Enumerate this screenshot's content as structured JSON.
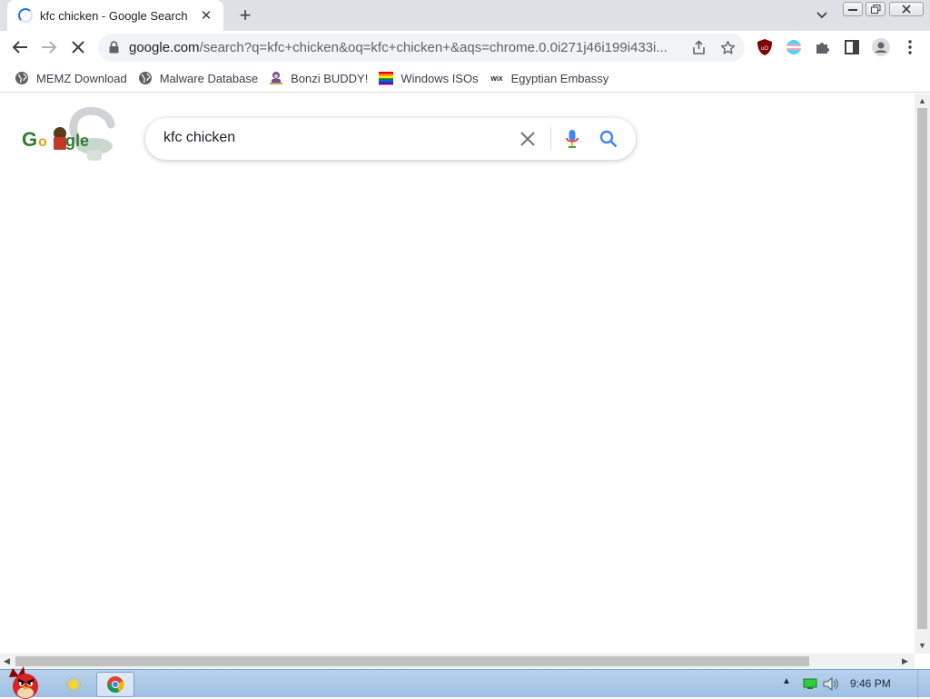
{
  "tab": {
    "title": "kfc chicken - Google Search",
    "close_glyph": "✕",
    "new_tab_glyph": "+"
  },
  "toolbar": {
    "url_host": "google.com",
    "url_path": "/search?q=kfc+chicken&oq=kfc+chicken+&aqs=chrome.0.0i271j46i199i433i..."
  },
  "bookmarks": [
    {
      "label": "MEMZ Download",
      "icon": "globe-icon"
    },
    {
      "label": "Malware Database",
      "icon": "globe-icon"
    },
    {
      "label": "Bonzi BUDDY!",
      "icon": "bonzi-icon"
    },
    {
      "label": "Windows ISOs",
      "icon": "rainbow-flag-icon"
    },
    {
      "label": "Egyptian Embassy",
      "icon": "wix-icon"
    }
  ],
  "search": {
    "query": "kfc chicken"
  },
  "taskbar": {
    "time": "9:46 PM"
  },
  "colors": {
    "accent": "#1a73e8",
    "tabstrip": "#dee1e6",
    "taskbar": "#a9c7e8"
  }
}
